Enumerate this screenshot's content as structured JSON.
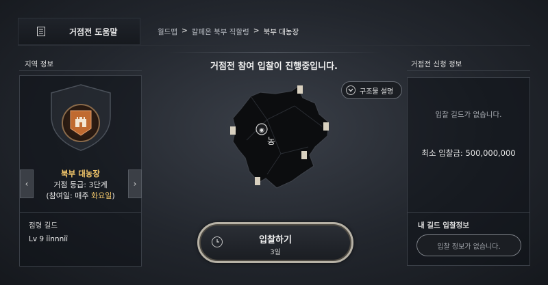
{
  "header": {
    "help_label": "거점전 도움말",
    "breadcrumb": [
      "월드맵",
      "칼페온 북부 직할령",
      "북부 대농장"
    ],
    "separator": ">"
  },
  "left": {
    "section_label": "지역 정보",
    "region_name": "북부 대농장",
    "grade": "거점 등급: 3단계",
    "participate_prefix": "(참여일: 매주 ",
    "participate_day": "화요일",
    "participate_suffix": ")",
    "prev_arrow": "‹",
    "next_arrow": "›",
    "guild_label": "점령 길드",
    "guild_value": "Lv 9 ỉỉnnnỉỉ"
  },
  "center": {
    "headline": "거점전 참여 입찰이 진행중입니다.",
    "structure_button": "구조물 설명",
    "map_label": "농",
    "bid_button": "입찰하기",
    "bid_sub": "3일"
  },
  "right": {
    "section_label": "거점전 신청 정보",
    "no_guild": "입찰 길드가 없습니다.",
    "min_bid": "최소 입찰금: 500,000,000",
    "my_guild_label": "내 길드 입찰정보",
    "my_bid_empty": "입찰 정보가 없습니다."
  },
  "colors": {
    "accent_gold": "#f2c66a",
    "emblem_orange": "#c06a30",
    "background": "#22262d"
  }
}
